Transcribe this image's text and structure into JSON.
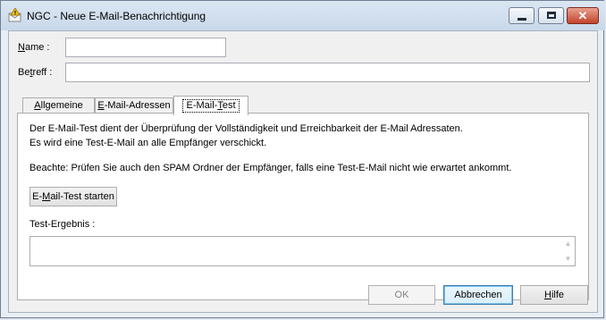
{
  "window": {
    "title": "NGC - Neue E-Mail-Benachrichtigung",
    "close_glyph": "✕"
  },
  "form": {
    "name_label_u": "N",
    "name_label_rest": "ame :",
    "name_value": "",
    "subject_label_pre": "Be",
    "subject_label_u": "t",
    "subject_label_rest": "reff :",
    "subject_value": ""
  },
  "tabs": {
    "general": {
      "u": "A",
      "rest": "llgemeine"
    },
    "addresses": {
      "u": "E",
      "rest": "-Mail-Adressen"
    },
    "test": {
      "pre": "E-Mail-",
      "u": "T",
      "rest": "est"
    }
  },
  "test_panel": {
    "intro_line1": "Der E-Mail-Test dient der Überprüfung der Vollständigkeit und Erreichbarkeit der E-Mail Adressaten.",
    "intro_line2": "Es wird eine Test-E-Mail an alle Empfänger verschickt.",
    "note": "Beachte: Prüfen Sie auch den SPAM Ordner der Empfänger, falls eine Test-E-Mail nicht wie erwartet ankommt.",
    "start_btn_pre": "E-",
    "start_btn_u": "M",
    "start_btn_rest": "ail-Test starten",
    "result_label": "Test-Ergebnis :",
    "result_value": ""
  },
  "footer": {
    "ok_label": "OK",
    "cancel_label": "Abbrechen",
    "help_u": "H",
    "help_rest": "ilfe"
  }
}
